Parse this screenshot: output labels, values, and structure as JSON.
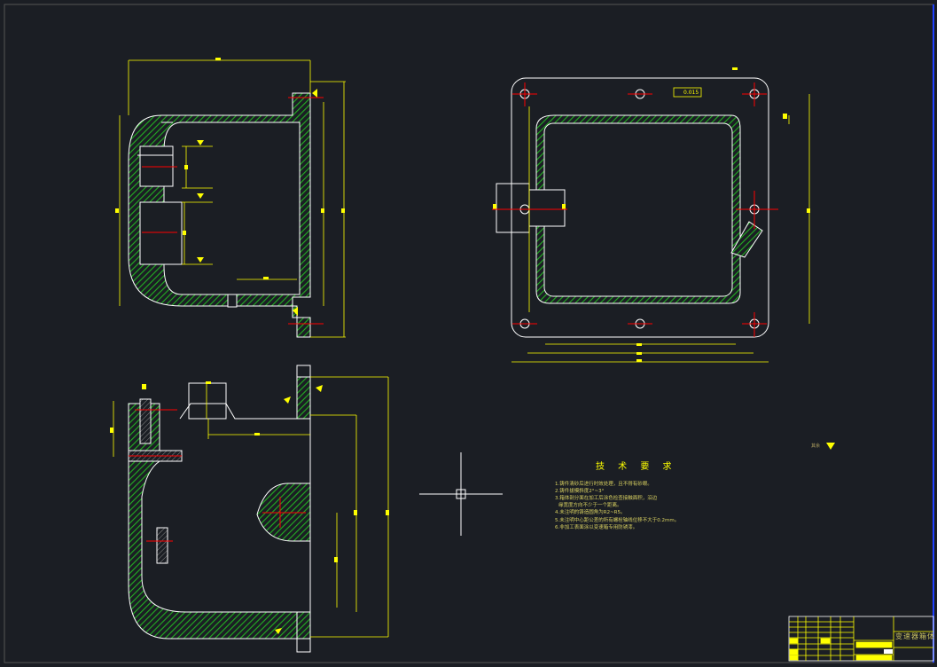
{
  "technical_requirements": {
    "title": "技 术 要 求",
    "lines": [
      "1.铸件清砂后进行时效处理，且不得有砂眼。",
      "2.铸件拔模斜度2°~3°",
      "3.箱体剖分面在加工后涂色检查接触面积，沿边",
      "缘宽度方向不少于一个距离。",
      "4.未注明的铸造圆角为R2~R5。",
      "5.未注明中心距公差的所有螺栓轴线位移不大于0.2mm。",
      "6.非加工表面涂以变速箱专用防锈漆。"
    ]
  },
  "title_block": {
    "drawing_name": "变速器箱体"
  },
  "roughness_note": "其余",
  "tolerance_value": "0.015",
  "colors": {
    "background": "#1b1e24",
    "outline": "#ffffff",
    "dimension": "#ffff00",
    "hatch": "#1aa01a",
    "centerline": "#ff0000",
    "frame": "#2040ff"
  }
}
